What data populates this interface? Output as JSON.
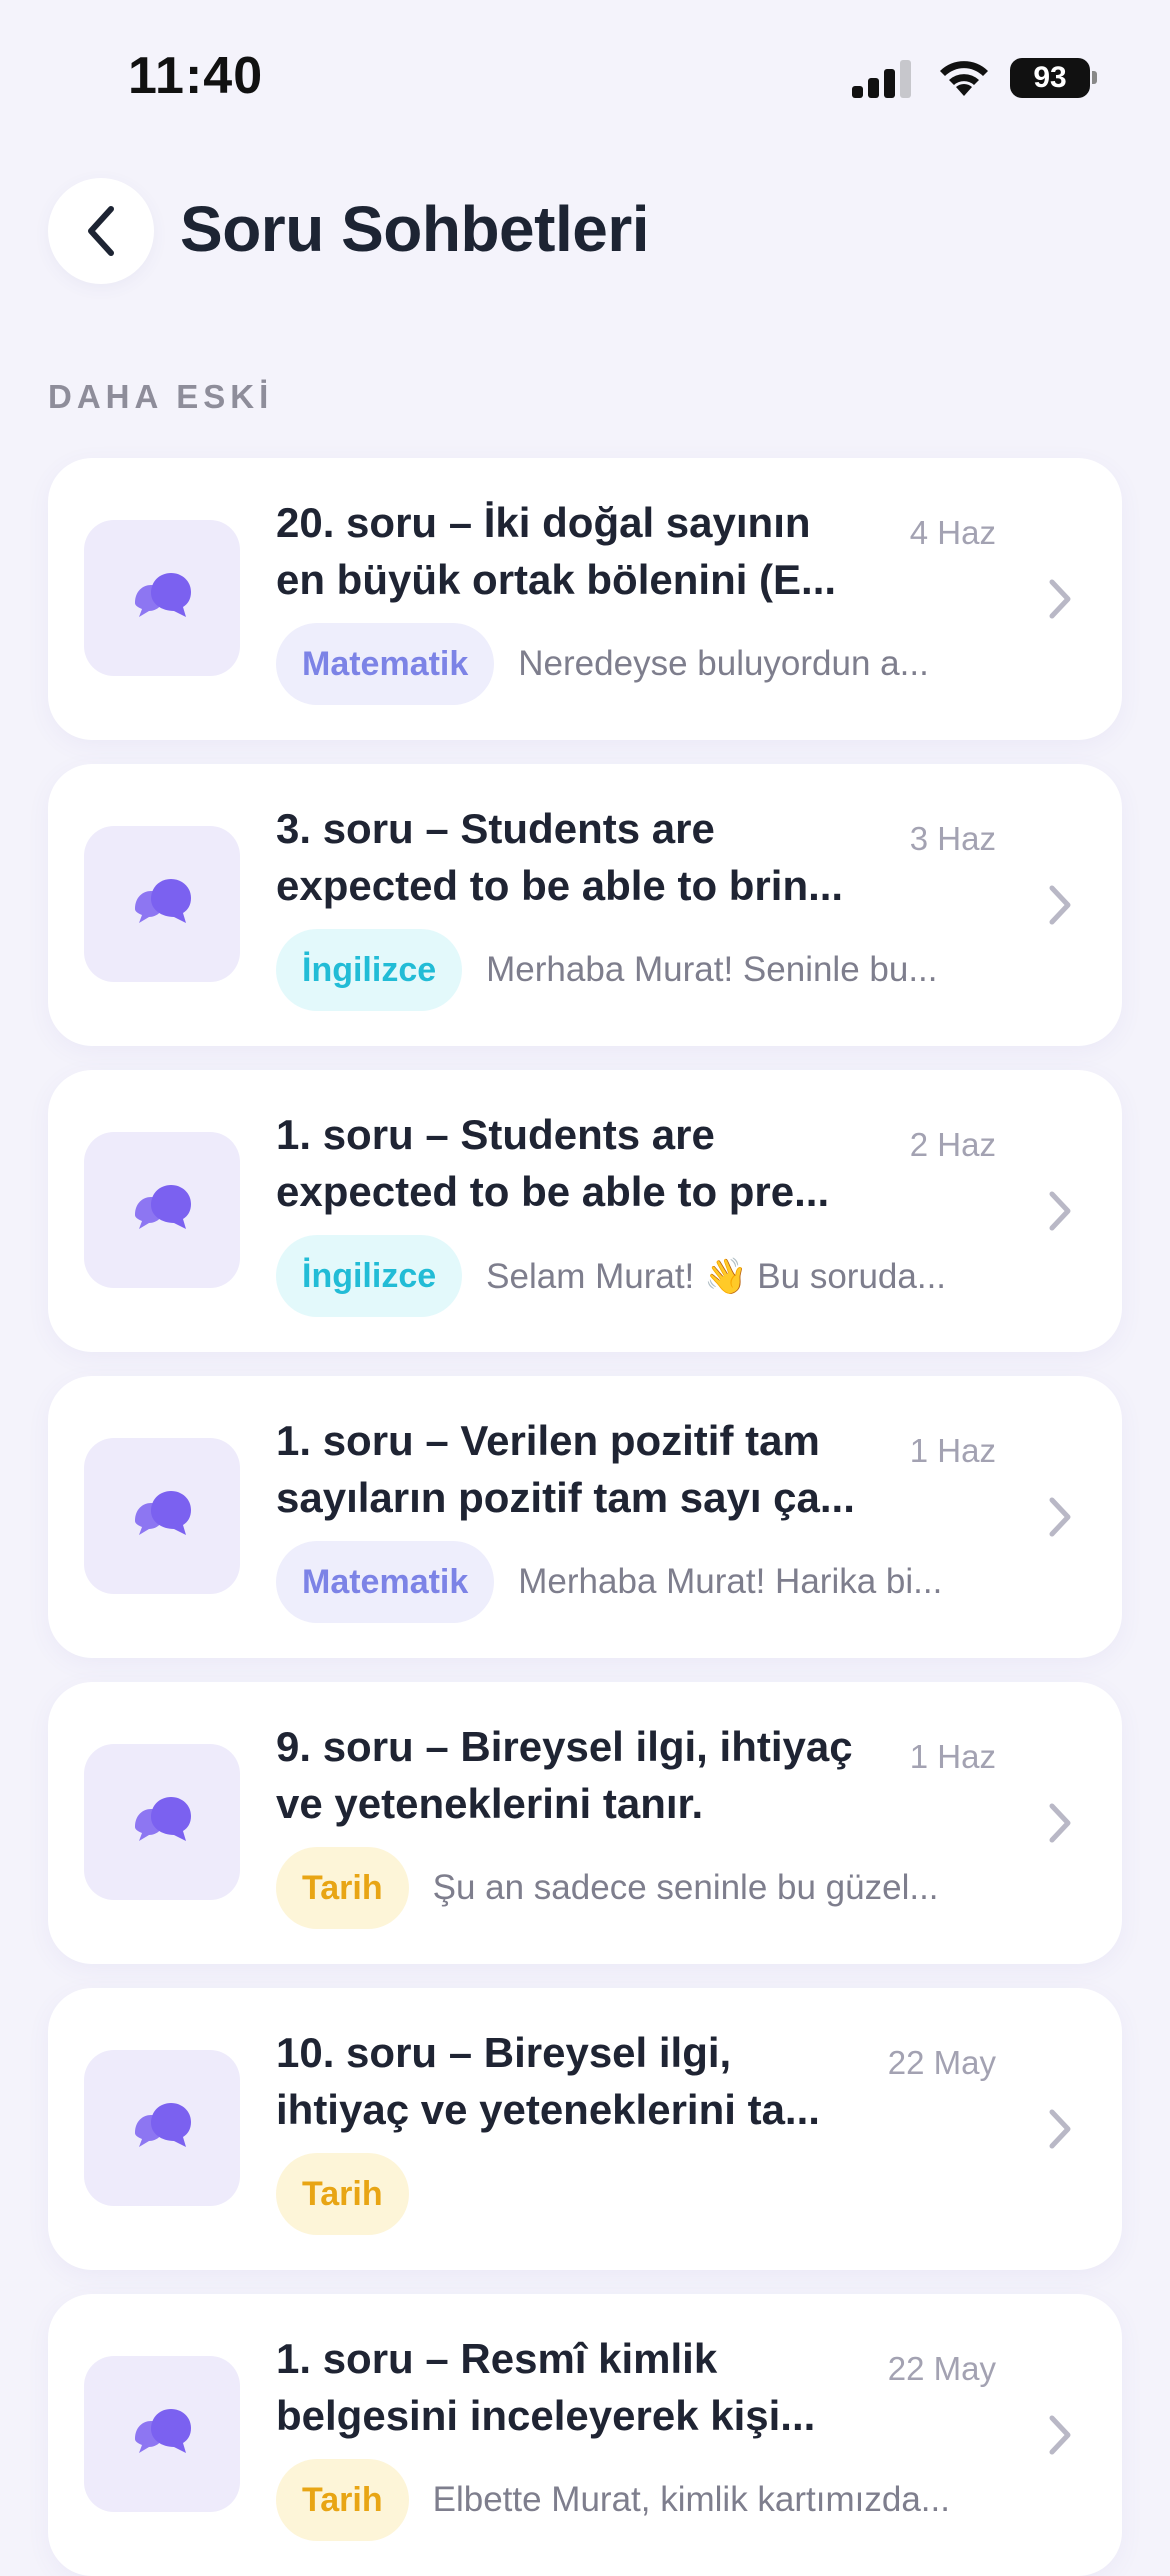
{
  "status_bar": {
    "time": "11:40",
    "battery": "93"
  },
  "header": {
    "title": "Soru Sohbetleri"
  },
  "section": {
    "label": "DAHA ESKİ"
  },
  "colors": {
    "accent": "#7b61f0",
    "background": "#f4f3fb"
  },
  "items": [
    {
      "title_line1": "20. soru – İki doğal sayının",
      "title_line2": "en büyük ortak bölenini (E...",
      "date": "4 Haz",
      "subject": "Matematik",
      "subject_key": "Matematik",
      "preview": "Neredeyse buluyordun a...",
      "icon": "chat-bubbles-icon"
    },
    {
      "title_line1": "3. soru – Students are",
      "title_line2": "expected to be able to brin...",
      "date": "3 Haz",
      "subject": "İngilizce",
      "subject_key": "Ingilizce",
      "preview": "Merhaba Murat! Seninle bu...",
      "icon": "chat-bubbles-icon"
    },
    {
      "title_line1": "1. soru – Students are",
      "title_line2": "expected to be able to pre...",
      "date": "2 Haz",
      "subject": "İngilizce",
      "subject_key": "Ingilizce",
      "preview": "Selam Murat! 👋 Bu soruda...",
      "icon": "chat-bubbles-icon"
    },
    {
      "title_line1": "1. soru – Verilen pozitif tam",
      "title_line2": "sayıların pozitif tam sayı ça...",
      "date": "1 Haz",
      "subject": "Matematik",
      "subject_key": "Matematik",
      "preview": "Merhaba Murat! Harika bi...",
      "icon": "chat-bubbles-icon"
    },
    {
      "title_line1": "9. soru – Bireysel ilgi, ihtiyaç",
      "title_line2": "ve yeteneklerini tanır.",
      "date": "1 Haz",
      "subject": "Tarih",
      "subject_key": "Tarih",
      "preview": "Şu an sadece seninle bu güzel...",
      "icon": "chat-bubbles-icon"
    },
    {
      "title_line1": "10. soru – Bireysel ilgi,",
      "title_line2": "ihtiyaç ve yeteneklerini ta...",
      "date": "22 May",
      "subject": "Tarih",
      "subject_key": "Tarih",
      "preview": "",
      "icon": "chat-bubbles-icon"
    },
    {
      "title_line1": "1. soru – Resmî kimlik",
      "title_line2": "belgesini inceleyerek kişi...",
      "date": "22 May",
      "subject": "Tarih",
      "subject_key": "Tarih",
      "preview": "Elbette Murat, kimlik kartımızda...",
      "icon": "chat-bubbles-icon"
    }
  ]
}
